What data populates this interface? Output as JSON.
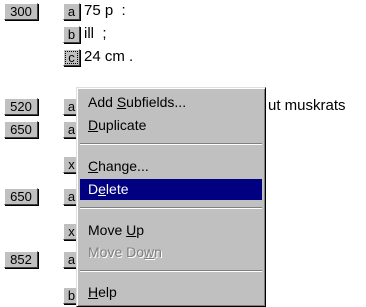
{
  "rows": [
    {
      "tag": "300",
      "sub": "a",
      "text": "75 p  :"
    },
    {
      "tag": "",
      "sub": "b",
      "text": "ill  ;"
    },
    {
      "tag": "",
      "sub": "c",
      "text": "24 cm ."
    },
    {
      "tag": "520",
      "sub": "a",
      "text": "ut muskrats"
    },
    {
      "tag": "650",
      "sub": "a",
      "text": ""
    },
    {
      "tag": "",
      "sub": "x",
      "text": ""
    },
    {
      "tag": "650",
      "sub": "a",
      "text": ""
    },
    {
      "tag": "",
      "sub": "x",
      "text": ""
    },
    {
      "tag": "852",
      "sub": "a",
      "text": ""
    },
    {
      "tag": "",
      "sub": "b",
      "text": ""
    }
  ],
  "context_menu": {
    "items": [
      {
        "pre": "Add ",
        "key": "S",
        "post": "ubfields..."
      },
      {
        "pre": "",
        "key": "D",
        "post": "uplicate"
      },
      {
        "pre": "",
        "key": "C",
        "post": "hange..."
      },
      {
        "pre": "D",
        "key": "e",
        "post": "lete"
      },
      {
        "pre": "Move ",
        "key": "U",
        "post": "p"
      },
      {
        "pre": "Move Do",
        "key": "w",
        "post": "n"
      },
      {
        "pre": "",
        "key": "H",
        "post": "elp"
      }
    ]
  },
  "colors": {
    "menu_bg": "#c0c0c0",
    "highlight": "#000080",
    "disabled": "#808080"
  }
}
